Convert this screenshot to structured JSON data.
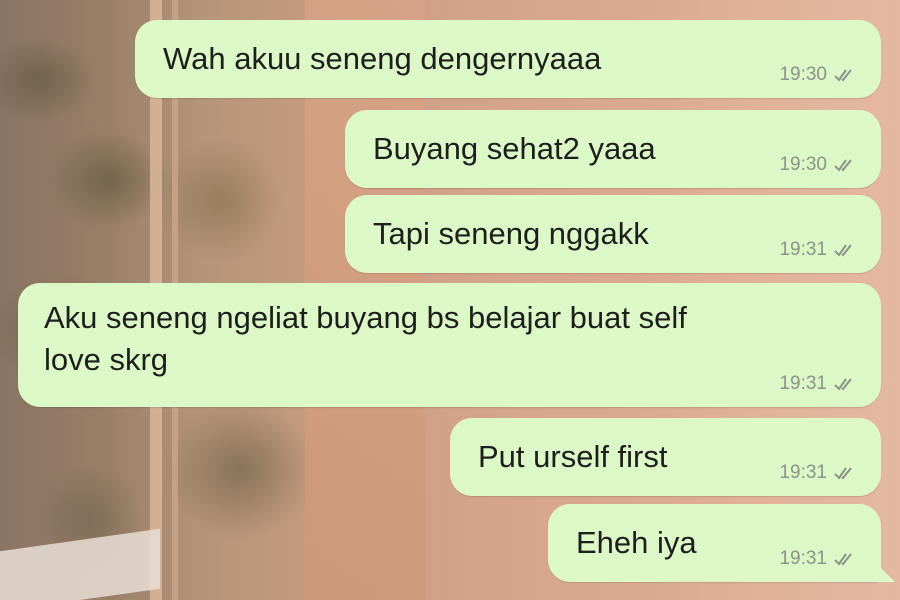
{
  "messages": [
    {
      "text": "Wah akuu seneng dengernyaaa",
      "time": "19:30",
      "status_icon": "double-check-icon"
    },
    {
      "text": "Buyang sehat2 yaaa",
      "time": "19:30",
      "status_icon": "double-check-icon"
    },
    {
      "text": "Tapi seneng nggakk",
      "time": "19:31",
      "status_icon": "double-check-icon"
    },
    {
      "text": "Aku seneng ngeliat buyang bs belajar buat self\nlove skrg",
      "time": "19:31",
      "status_icon": "double-check-icon"
    },
    {
      "text": "Put urself first",
      "time": "19:31",
      "status_icon": "double-check-icon"
    },
    {
      "text": "Eheh iya",
      "time": "19:31",
      "status_icon": "double-check-icon"
    }
  ],
  "colors": {
    "outgoing_bubble": "#dcf8c6",
    "meta_text": "#8b938a",
    "message_text": "#1e1e1e"
  }
}
